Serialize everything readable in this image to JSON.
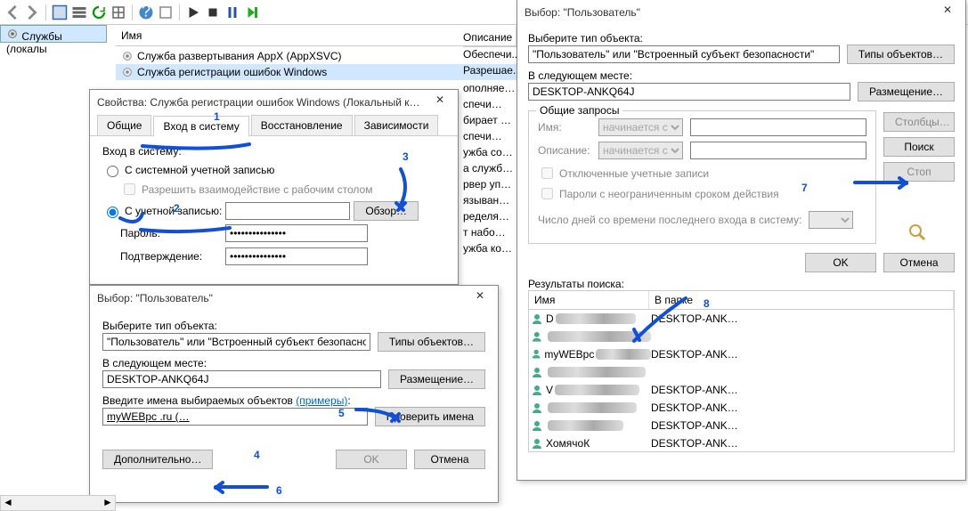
{
  "toolbar": {},
  "left_pane": {
    "label": "Службы (локалы"
  },
  "services": {
    "col_name": "Имя",
    "col_desc": "Описание",
    "rows": [
      {
        "name": "Служба развертывания AppX (AppXSVC)",
        "desc": "Обеспечи..."
      },
      {
        "name": "Служба регистрации ошибок Windows",
        "desc": "Разрешае..."
      }
    ],
    "desc_tail": [
      "ополняе…",
      "спечи…",
      "бирает …",
      "спечи…",
      "ужба со…",
      "а служб…",
      "рвер уп…",
      "языван…",
      "ределя…",
      "т набо…",
      "ужба ко…"
    ]
  },
  "props": {
    "title": "Свойства: Служба регистрации ошибок Windows (Локальный к…",
    "tabs": {
      "general": "Общие",
      "logon": "Вход в систему",
      "recovery": "Восстановление",
      "deps": "Зависимости"
    },
    "logon_label": "Вход в систему:",
    "local_system": "С системной учетной записью",
    "allow_desktop": "Разрешить взаимодействие с рабочим столом",
    "this_account": "С учетной записью:",
    "browse": "Обзор…",
    "password": "Пароль:",
    "confirm": "Подтверждение:",
    "pwd_value": "•••••••••••••••"
  },
  "select1": {
    "title": "Выбор: \"Пользователь\"",
    "obj_type_label": "Выберите тип объекта:",
    "obj_type_value": "\"Пользователь\" или \"Встроенный субъект безопасности\"",
    "obj_types_btn": "Типы объектов…",
    "from_label": "В следующем месте:",
    "from_value": "DESKTOP-ANKQ64J",
    "locations_btn": "Размещение…",
    "enter_names_label": "Введите имена выбираемых объектов",
    "examples": "(примеры)",
    "entered_value": "myWEBpc .ru (…",
    "check_names": "Проверить имена",
    "advanced": "Дополнительно…",
    "ok": "OK",
    "cancel": "Отмена"
  },
  "select2": {
    "title": "Выбор: \"Пользователь\"",
    "obj_type_label": "Выберите тип объекта:",
    "obj_type_value": "\"Пользователь\" или \"Встроенный субъект безопасности\"",
    "obj_types_btn": "Типы объектов…",
    "from_label": "В следующем месте:",
    "from_value": "DESKTOP-ANKQ64J",
    "locations_btn": "Размещение…",
    "common_queries": "Общие запросы",
    "name_label": "Имя:",
    "desc_label": "Описание:",
    "starts_with": "начинается с",
    "disabled_cb": "Отключенные учетные записи",
    "nonexp_cb": "Пароли с неограниченным сроком действия",
    "days_label": "Число дней со времени последнего входа в систему:",
    "columns_btn": "Столбцы…",
    "find_btn": "Поиск",
    "stop_btn": "Стоп",
    "ok": "OK",
    "cancel": "Отмена",
    "results_label": "Результаты поиска:",
    "col_name": "Имя",
    "col_folder": "В папке",
    "results": [
      {
        "name": "D",
        "folder": "DESKTOP-ANK…",
        "smear": 90
      },
      {
        "name": "",
        "folder": "",
        "smear": 120
      },
      {
        "name": "myWEBpc",
        "folder": "DESKTOP-ANK…",
        "smear": 70
      },
      {
        "name": "",
        "folder": "",
        "smear": 110
      },
      {
        "name": "V",
        "folder": "DESKTOP-ANK…",
        "smear": 95
      },
      {
        "name": "",
        "folder": "DESKTOP-ANK…",
        "smear": 100
      },
      {
        "name": "",
        "folder": "DESKTOP-ANK…",
        "smear": 85
      },
      {
        "name": "ХомячоК",
        "folder": "DESKTOP-ANK…",
        "smear": 0
      }
    ]
  },
  "annotations": {
    "n1": "1",
    "n2": "2",
    "n3": "3",
    "n4": "4",
    "n5": "5",
    "n6": "6",
    "n7": "7",
    "n8": "8"
  }
}
